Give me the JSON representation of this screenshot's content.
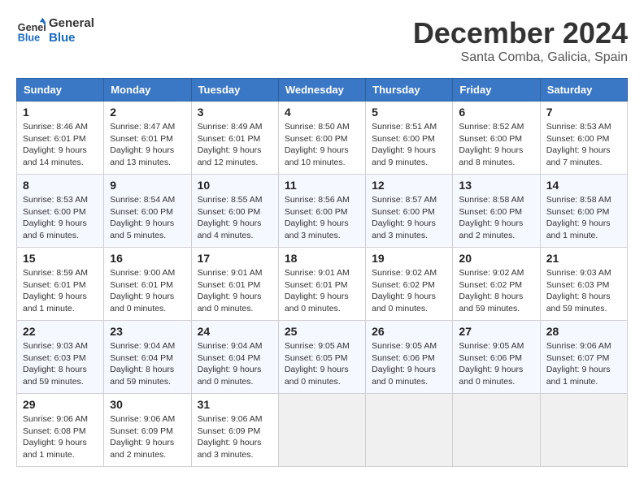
{
  "logo": {
    "line1": "General",
    "line2": "Blue"
  },
  "title": "December 2024",
  "location": "Santa Comba, Galicia, Spain",
  "weekdays": [
    "Sunday",
    "Monday",
    "Tuesday",
    "Wednesday",
    "Thursday",
    "Friday",
    "Saturday"
  ],
  "weeks": [
    [
      {
        "day": 1,
        "sunrise": "8:46 AM",
        "sunset": "6:01 PM",
        "daylight": "9 hours and 14 minutes."
      },
      {
        "day": 2,
        "sunrise": "8:47 AM",
        "sunset": "6:01 PM",
        "daylight": "9 hours and 13 minutes."
      },
      {
        "day": 3,
        "sunrise": "8:49 AM",
        "sunset": "6:01 PM",
        "daylight": "9 hours and 12 minutes."
      },
      {
        "day": 4,
        "sunrise": "8:50 AM",
        "sunset": "6:00 PM",
        "daylight": "9 hours and 10 minutes."
      },
      {
        "day": 5,
        "sunrise": "8:51 AM",
        "sunset": "6:00 PM",
        "daylight": "9 hours and 9 minutes."
      },
      {
        "day": 6,
        "sunrise": "8:52 AM",
        "sunset": "6:00 PM",
        "daylight": "9 hours and 8 minutes."
      },
      {
        "day": 7,
        "sunrise": "8:53 AM",
        "sunset": "6:00 PM",
        "daylight": "9 hours and 7 minutes."
      }
    ],
    [
      {
        "day": 8,
        "sunrise": "8:53 AM",
        "sunset": "6:00 PM",
        "daylight": "9 hours and 6 minutes."
      },
      {
        "day": 9,
        "sunrise": "8:54 AM",
        "sunset": "6:00 PM",
        "daylight": "9 hours and 5 minutes."
      },
      {
        "day": 10,
        "sunrise": "8:55 AM",
        "sunset": "6:00 PM",
        "daylight": "9 hours and 4 minutes."
      },
      {
        "day": 11,
        "sunrise": "8:56 AM",
        "sunset": "6:00 PM",
        "daylight": "9 hours and 3 minutes."
      },
      {
        "day": 12,
        "sunrise": "8:57 AM",
        "sunset": "6:00 PM",
        "daylight": "9 hours and 3 minutes."
      },
      {
        "day": 13,
        "sunrise": "8:58 AM",
        "sunset": "6:00 PM",
        "daylight": "9 hours and 2 minutes."
      },
      {
        "day": 14,
        "sunrise": "8:58 AM",
        "sunset": "6:00 PM",
        "daylight": "9 hours and 1 minute."
      }
    ],
    [
      {
        "day": 15,
        "sunrise": "8:59 AM",
        "sunset": "6:01 PM",
        "daylight": "9 hours and 1 minute."
      },
      {
        "day": 16,
        "sunrise": "9:00 AM",
        "sunset": "6:01 PM",
        "daylight": "9 hours and 0 minutes."
      },
      {
        "day": 17,
        "sunrise": "9:01 AM",
        "sunset": "6:01 PM",
        "daylight": "9 hours and 0 minutes."
      },
      {
        "day": 18,
        "sunrise": "9:01 AM",
        "sunset": "6:01 PM",
        "daylight": "9 hours and 0 minutes."
      },
      {
        "day": 19,
        "sunrise": "9:02 AM",
        "sunset": "6:02 PM",
        "daylight": "9 hours and 0 minutes."
      },
      {
        "day": 20,
        "sunrise": "9:02 AM",
        "sunset": "6:02 PM",
        "daylight": "8 hours and 59 minutes."
      },
      {
        "day": 21,
        "sunrise": "9:03 AM",
        "sunset": "6:03 PM",
        "daylight": "8 hours and 59 minutes."
      }
    ],
    [
      {
        "day": 22,
        "sunrise": "9:03 AM",
        "sunset": "6:03 PM",
        "daylight": "8 hours and 59 minutes."
      },
      {
        "day": 23,
        "sunrise": "9:04 AM",
        "sunset": "6:04 PM",
        "daylight": "8 hours and 59 minutes."
      },
      {
        "day": 24,
        "sunrise": "9:04 AM",
        "sunset": "6:04 PM",
        "daylight": "9 hours and 0 minutes."
      },
      {
        "day": 25,
        "sunrise": "9:05 AM",
        "sunset": "6:05 PM",
        "daylight": "9 hours and 0 minutes."
      },
      {
        "day": 26,
        "sunrise": "9:05 AM",
        "sunset": "6:06 PM",
        "daylight": "9 hours and 0 minutes."
      },
      {
        "day": 27,
        "sunrise": "9:05 AM",
        "sunset": "6:06 PM",
        "daylight": "9 hours and 0 minutes."
      },
      {
        "day": 28,
        "sunrise": "9:06 AM",
        "sunset": "6:07 PM",
        "daylight": "9 hours and 1 minute."
      }
    ],
    [
      {
        "day": 29,
        "sunrise": "9:06 AM",
        "sunset": "6:08 PM",
        "daylight": "9 hours and 1 minute."
      },
      {
        "day": 30,
        "sunrise": "9:06 AM",
        "sunset": "6:09 PM",
        "daylight": "9 hours and 2 minutes."
      },
      {
        "day": 31,
        "sunrise": "9:06 AM",
        "sunset": "6:09 PM",
        "daylight": "9 hours and 3 minutes."
      },
      null,
      null,
      null,
      null
    ]
  ],
  "labels": {
    "sunrise": "Sunrise:",
    "sunset": "Sunset:",
    "daylight": "Daylight:"
  }
}
